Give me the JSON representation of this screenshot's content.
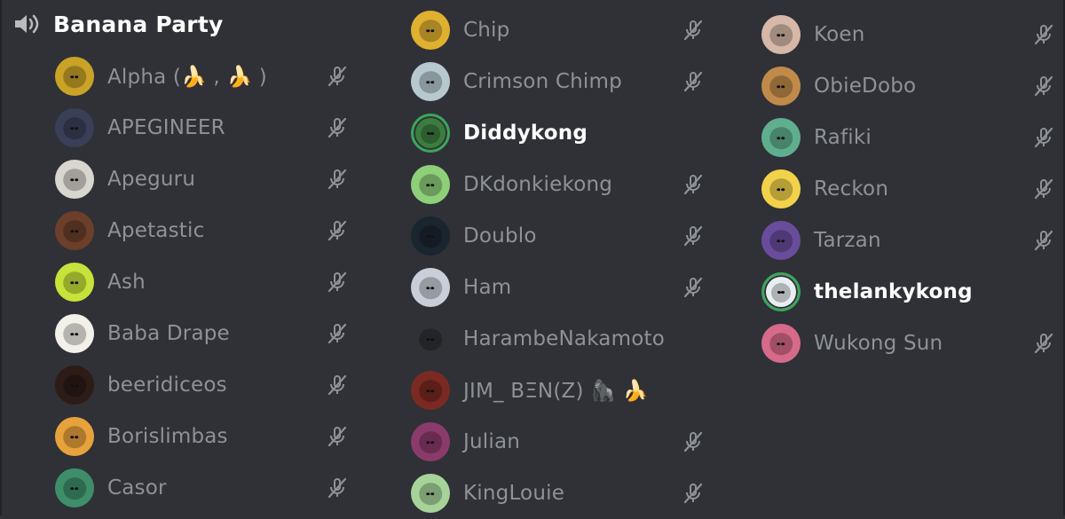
{
  "channel": {
    "name": "Banana Party",
    "icon": "speaker-icon"
  },
  "colors": {
    "background": "#2f3136",
    "text_muted": "#8e9297",
    "text_active": "#ffffff",
    "speaking_ring": "#3ba55c"
  },
  "columns": [
    [
      {
        "name": "Alpha (🍌 , 🍌 )",
        "muted": true,
        "speaking": false,
        "color": "#c9a227"
      },
      {
        "name": "APEGINEER",
        "muted": true,
        "speaking": false,
        "color": "#3a3f58"
      },
      {
        "name": "Apeguru",
        "muted": true,
        "speaking": false,
        "color": "#d9d5cf"
      },
      {
        "name": "Apetastic",
        "muted": true,
        "speaking": false,
        "color": "#6b3f2a"
      },
      {
        "name": "Ash",
        "muted": true,
        "speaking": false,
        "color": "#c7e23a"
      },
      {
        "name": "Baba Drape",
        "muted": true,
        "speaking": false,
        "color": "#f3f0ea"
      },
      {
        "name": "beeridiceos",
        "muted": true,
        "speaking": false,
        "color": "#2d1b16"
      },
      {
        "name": "Borislimbas",
        "muted": true,
        "speaking": false,
        "color": "#e8a23b"
      },
      {
        "name": "Casor",
        "muted": true,
        "speaking": false,
        "color": "#3e8e6a"
      }
    ],
    [
      {
        "name": "Chip",
        "muted": true,
        "speaking": false,
        "color": "#e0b030"
      },
      {
        "name": "Crimson Chimp",
        "muted": true,
        "speaking": false,
        "color": "#b7c9cf"
      },
      {
        "name": "Diddykong",
        "muted": false,
        "speaking": true,
        "color": "#3b7d3e"
      },
      {
        "name": "DKdonkiekong",
        "muted": true,
        "speaking": false,
        "color": "#8ecf7a"
      },
      {
        "name": "Doublo",
        "muted": true,
        "speaking": false,
        "color": "#1b2530"
      },
      {
        "name": "Ham",
        "muted": true,
        "speaking": false,
        "color": "#c9cfd8"
      },
      {
        "name": "HarambeNakamoto",
        "muted": false,
        "speaking": false,
        "color": "#2f3136"
      },
      {
        "name": "JIM_ BΞN(Z) 🦍 🍌",
        "muted": false,
        "speaking": false,
        "color": "#7a2a22"
      },
      {
        "name": "Julian",
        "muted": true,
        "speaking": false,
        "color": "#8b3b6b"
      },
      {
        "name": "KingLouie",
        "muted": true,
        "speaking": false,
        "color": "#a6d39a"
      }
    ],
    [
      {
        "name": "Koen",
        "muted": true,
        "speaking": false,
        "color": "#d7b8a8"
      },
      {
        "name": "ObieDobo",
        "muted": true,
        "speaking": false,
        "color": "#c08a4a"
      },
      {
        "name": "Rafiki",
        "muted": true,
        "speaking": false,
        "color": "#5faf8e"
      },
      {
        "name": "Reckon",
        "muted": true,
        "speaking": false,
        "color": "#f2d24a"
      },
      {
        "name": "Tarzan",
        "muted": true,
        "speaking": false,
        "color": "#6a4c9c"
      },
      {
        "name": "thelankykong",
        "muted": false,
        "speaking": true,
        "color": "#e9eef2"
      },
      {
        "name": "Wukong Sun",
        "muted": true,
        "speaking": false,
        "color": "#d66a8a"
      }
    ]
  ]
}
